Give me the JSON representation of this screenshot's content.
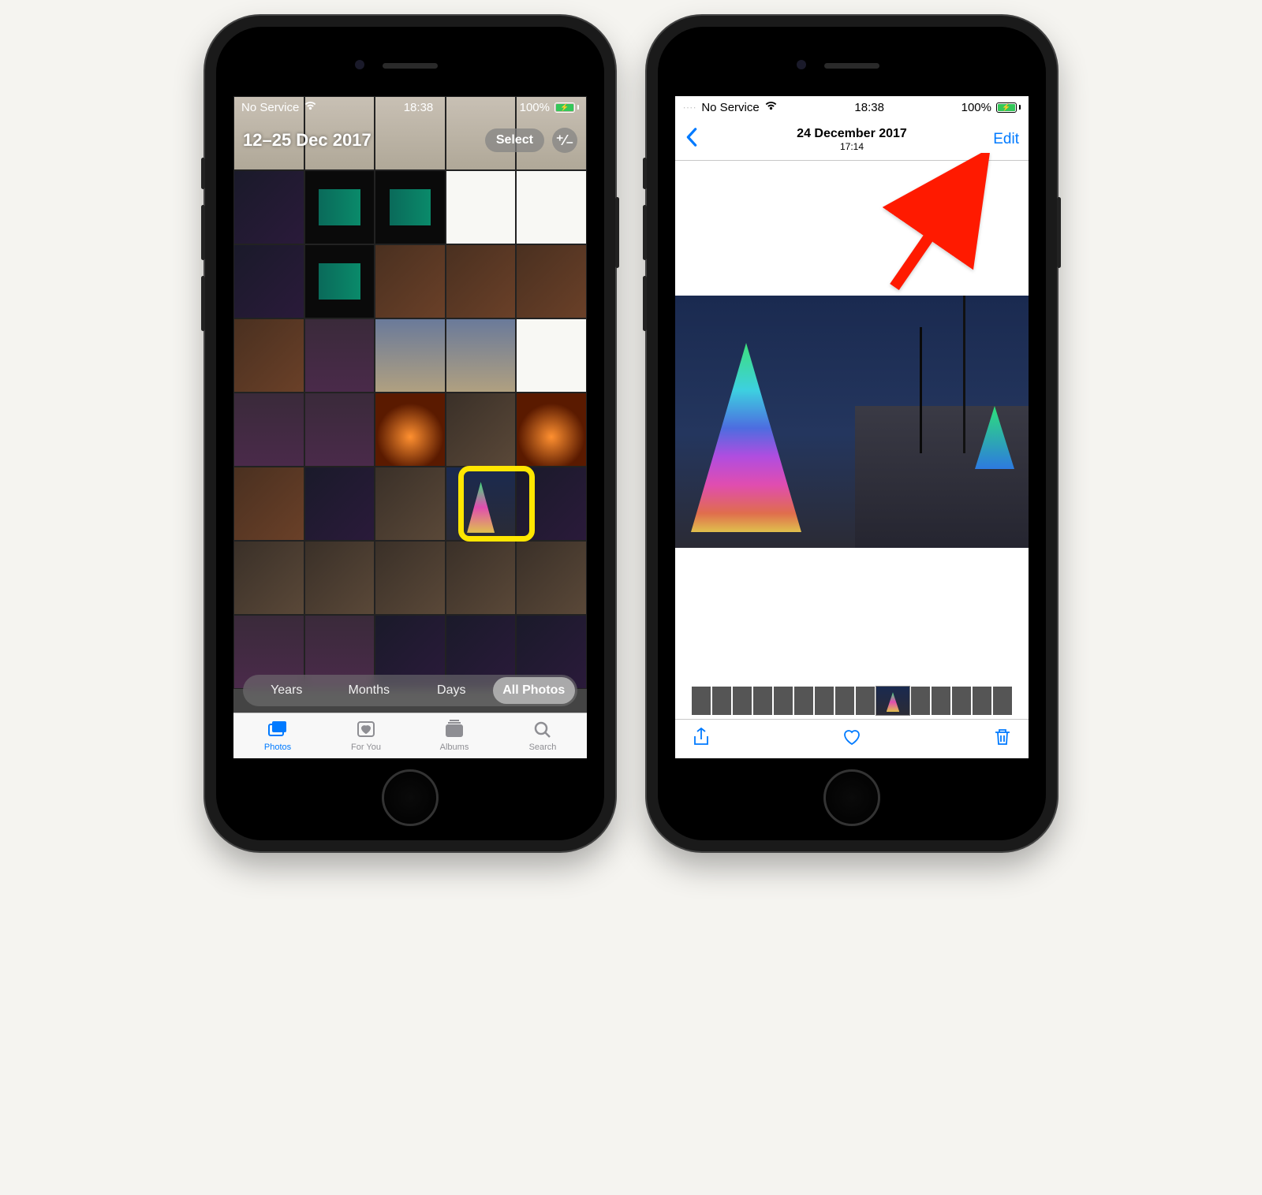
{
  "phone1": {
    "status": {
      "carrier": "No Service",
      "time": "18:38",
      "battery": "100%"
    },
    "header": {
      "date_range": "12–25 Dec 2017",
      "select_label": "Select",
      "zoom_label": "⁺⁄₋"
    },
    "segments": [
      "Years",
      "Months",
      "Days",
      "All Photos"
    ],
    "active_segment": 3,
    "tabs": [
      {
        "label": "Photos",
        "icon": "photos-icon"
      },
      {
        "label": "For You",
        "icon": "heart-square-icon"
      },
      {
        "label": "Albums",
        "icon": "albums-icon"
      },
      {
        "label": "Search",
        "icon": "search-icon"
      }
    ],
    "active_tab": 0,
    "highlighted_thumb_index": 28,
    "grid_thumbs": [
      "doc",
      "doc",
      "doc",
      "doc",
      "doc",
      "dark",
      "clk",
      "clk",
      "text",
      "text",
      "dark",
      "clk",
      "warm",
      "warm",
      "warm",
      "warm",
      "room",
      "out",
      "out",
      "text",
      "room",
      "room",
      "fire",
      "ppl",
      "fire",
      "warm",
      "dark",
      "ppl",
      "treeTh",
      "dark",
      "ppl",
      "ppl",
      "ppl",
      "ppl",
      "ppl",
      "room",
      "room",
      "dark",
      "dark",
      "dark"
    ]
  },
  "phone2": {
    "status": {
      "carrier": "No Service",
      "time": "18:38",
      "battery": "100%"
    },
    "nav": {
      "title": "24 December 2017",
      "subtitle": "17:14",
      "edit_label": "Edit"
    },
    "strip_thumbs": [
      "room",
      "room",
      "ppl",
      "dark",
      "ppl",
      "fire",
      "warm",
      "dark",
      "ppl",
      "treeTh",
      "dark",
      "ppl",
      "ppl",
      "ppl",
      "ppl"
    ],
    "strip_current_index": 9,
    "toolbar": {
      "share": "share-icon",
      "favorite": "heart-icon",
      "delete": "trash-icon"
    }
  },
  "annotation": {
    "arrow_target": "edit-button",
    "highlight_target": "rainbow-tree-thumbnail"
  }
}
